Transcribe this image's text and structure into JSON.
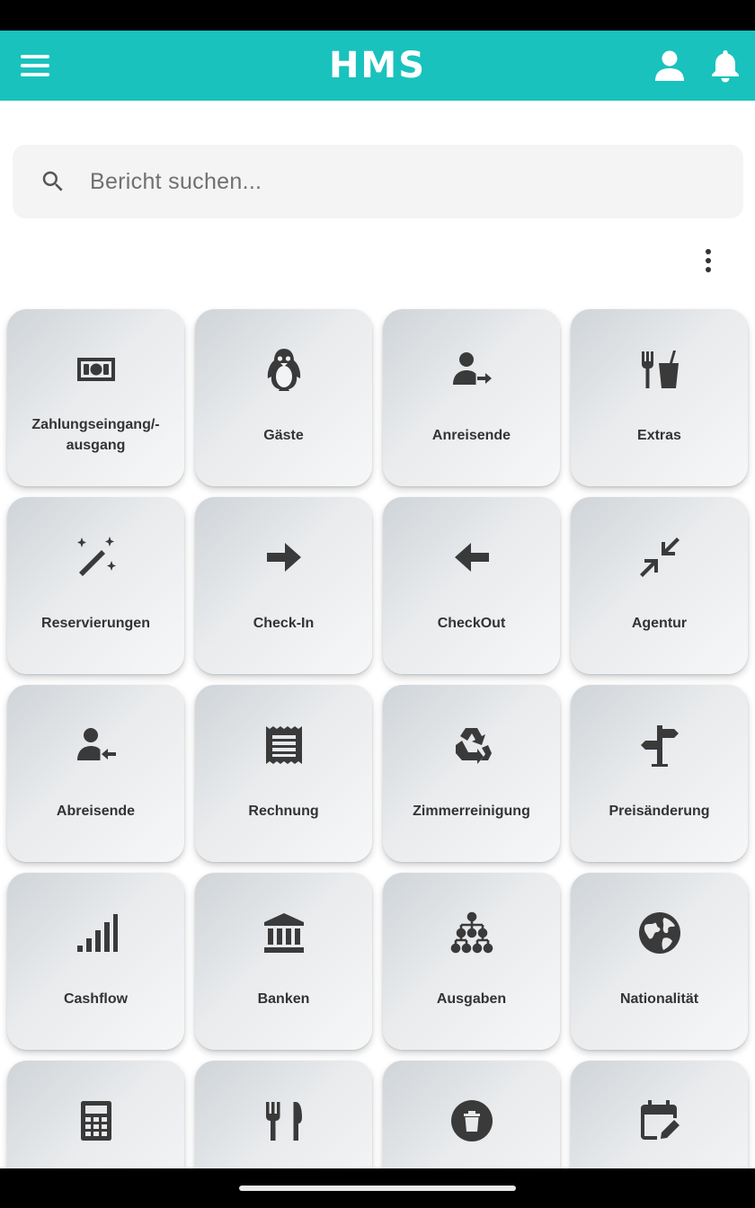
{
  "colors": {
    "accent": "#19c2bd",
    "icon": "#3a3a3a",
    "tile_text": "#333333"
  },
  "header": {
    "brand": "HMS",
    "menu_icon": "menu-icon",
    "profile_icon": "person-icon",
    "notifications_icon": "bell-icon"
  },
  "search": {
    "placeholder": "Bericht suchen...",
    "value": ""
  },
  "toolbar": {
    "more_icon": "more-vert-icon"
  },
  "tiles": [
    {
      "label": "Zahlungseingang/-ausgang",
      "icon": "money-icon"
    },
    {
      "label": "Gäste",
      "icon": "penguin-icon"
    },
    {
      "label": "Anreisende",
      "icon": "person-arrow-right-icon"
    },
    {
      "label": "Extras",
      "icon": "food-drink-icon"
    },
    {
      "label": "Reservierungen",
      "icon": "magic-wand-icon"
    },
    {
      "label": "Check-In",
      "icon": "arrow-right-icon"
    },
    {
      "label": "CheckOut",
      "icon": "arrow-left-icon"
    },
    {
      "label": "Agentur",
      "icon": "collapse-arrows-icon"
    },
    {
      "label": "Abreisende",
      "icon": "person-arrow-left-icon"
    },
    {
      "label": "Rechnung",
      "icon": "receipt-icon"
    },
    {
      "label": "Zimmerreinigung",
      "icon": "recycle-icon"
    },
    {
      "label": "Preisänderung",
      "icon": "signpost-icon"
    },
    {
      "label": "Cashflow",
      "icon": "signal-bars-icon"
    },
    {
      "label": "Banken",
      "icon": "bank-icon"
    },
    {
      "label": "Ausgaben",
      "icon": "hierarchy-icon"
    },
    {
      "label": "Nationalität",
      "icon": "globe-icon"
    },
    {
      "label": "",
      "icon": "calculator-icon"
    },
    {
      "label": "",
      "icon": "cutlery-icon"
    },
    {
      "label": "",
      "icon": "trash-icon"
    },
    {
      "label": "",
      "icon": "calendar-edit-icon"
    }
  ]
}
